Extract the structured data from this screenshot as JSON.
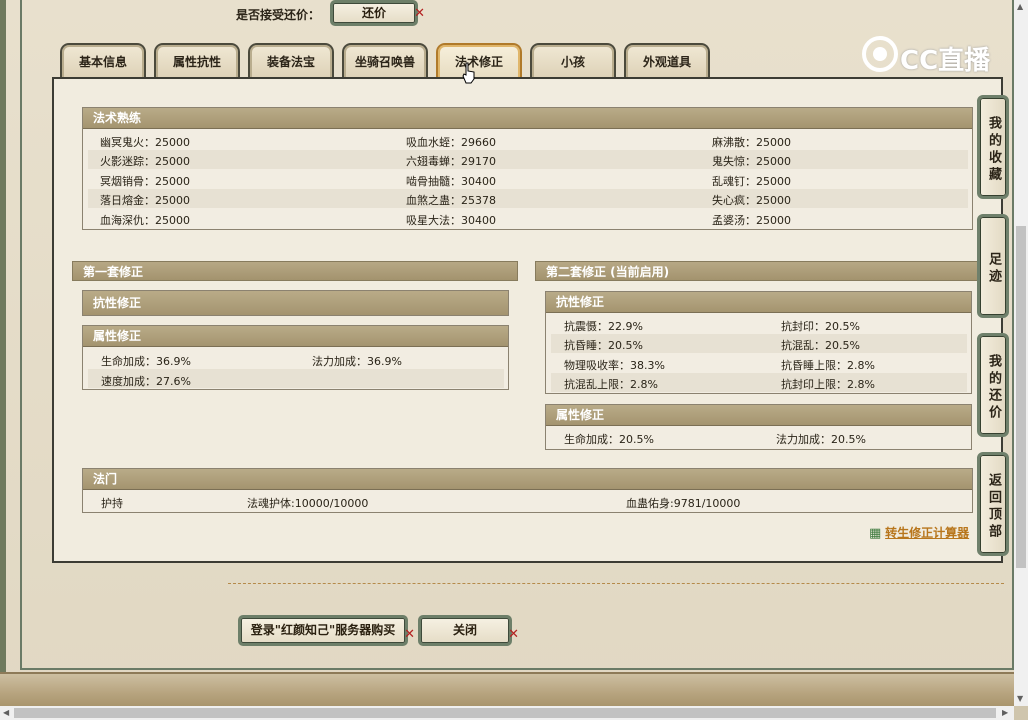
{
  "top": {
    "accept_label": "是否接受还价：",
    "counter_offer_button": "还价"
  },
  "tabs": [
    {
      "label": "基本信息"
    },
    {
      "label": "属性抗性"
    },
    {
      "label": "装备法宝"
    },
    {
      "label": "坐骑召唤兽"
    },
    {
      "label": "法术修正",
      "active": true
    },
    {
      "label": "小孩"
    },
    {
      "label": "外观道具"
    }
  ],
  "watermark": {
    "text": "CC直播"
  },
  "spell_mastery": {
    "title": "法术熟练",
    "rows": [
      [
        "幽冥鬼火：25000",
        "吸血水蛭：29660",
        "麻沸散：25000"
      ],
      [
        "火影迷踪：25000",
        "六翅毒蝉：29170",
        "鬼失惊：25000"
      ],
      [
        "冥烟销骨：25000",
        "啮骨抽髓：30400",
        "乱魂钉：25000"
      ],
      [
        "落日熔金：25000",
        "血煞之蛊：25378",
        "失心疯：25000"
      ],
      [
        "血海深仇：25000",
        "吸星大法：30400",
        "孟婆汤：25000"
      ]
    ]
  },
  "set1": {
    "title": "第一套修正",
    "resist_title": "抗性修正",
    "attr_title": "属性修正",
    "attr_rows": [
      [
        "生命加成：36.9%",
        "法力加成：36.9%"
      ],
      [
        "速度加成：27.6%",
        ""
      ]
    ]
  },
  "set2": {
    "title": "第二套修正 (当前启用)",
    "resist_title": "抗性修正",
    "resist_rows": [
      [
        "抗震慑：22.9%",
        "抗封印：20.5%"
      ],
      [
        "抗昏睡：20.5%",
        "抗混乱：20.5%"
      ],
      [
        "物理吸收率：38.3%",
        "抗昏睡上限：2.8%"
      ],
      [
        "抗混乱上限：2.8%",
        "抗封印上限：2.8%"
      ]
    ],
    "attr_title": "属性修正",
    "attr_rows": [
      [
        "生命加成：20.5%",
        "法力加成：20.5%"
      ]
    ]
  },
  "sect": {
    "title": "法门",
    "row": [
      "护持",
      "法魂护体:10000/10000",
      "血蛊佑身:9781/10000"
    ]
  },
  "calc_link": "转生修正计算器",
  "side_buttons": [
    "我的收藏",
    "足迹",
    "我的还价",
    "返回顶部"
  ],
  "bottom": {
    "login_button": "登录\"红颜知己\"服务器购买",
    "close_button": "关闭"
  }
}
